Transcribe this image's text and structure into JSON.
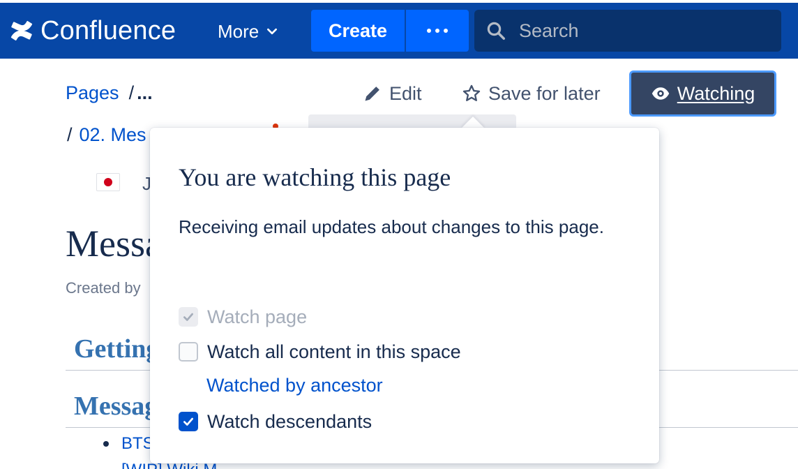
{
  "nav": {
    "logo_text": "Confluence",
    "more_label": "More",
    "create_label": "Create",
    "create_more_icon": "more-dots-icon",
    "search_placeholder": "Search",
    "colors": {
      "nav_bg": "#0747a6",
      "create_bg": "#0065ff",
      "search_bg": "#09326c"
    }
  },
  "breadcrumb": {
    "first": "Pages",
    "sep": "/",
    "ellipsis": "...",
    "second": "02. Mes"
  },
  "actions": {
    "edit_label": "Edit",
    "save_label": "Save for later",
    "watching_label": "Watching"
  },
  "page": {
    "title": "Messa",
    "created_by": "Created by",
    "flag_char": "J",
    "heading_getting": "Getting",
    "heading_messages": "Messag",
    "bullet_item": "BTS",
    "bullet_item_2": "[WIP] Wiki M"
  },
  "popover": {
    "title": "You are watching this page",
    "description": "Receiving email updates about changes to this page.",
    "options": [
      {
        "label": "Watch page",
        "checked": true,
        "disabled": true
      },
      {
        "label": "Watch all content in this space",
        "checked": false,
        "disabled": false
      },
      {
        "label": "Watch descendants",
        "checked": true,
        "disabled": false
      }
    ],
    "ancestor_link": "Watched by ancestor"
  }
}
